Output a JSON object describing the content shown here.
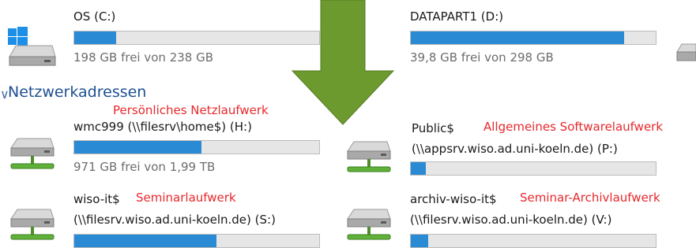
{
  "local_drives": [
    {
      "name": "OS (C:)",
      "free_text": "198 GB frei von 238 GB",
      "used_fraction": 0.17
    },
    {
      "name": "DATAPART1 (D:)",
      "free_text": "39,8 GB frei von 298 GB",
      "used_fraction": 0.87
    }
  ],
  "network_section": {
    "title": "Netzwerkadressen",
    "chevron_icon": "chevron-down-icon"
  },
  "network_drives": [
    {
      "name": "wmc999 (\\\\filesrv\\home$) (H:)",
      "annotation": "Persönliches Netzlaufwerk",
      "free_text": "971 GB frei von 1,99 TB",
      "used_fraction": 0.52
    },
    {
      "name": "Public$",
      "path": "(\\\\appsrv.wiso.ad.uni-koeln.de) (P:)",
      "annotation": "Allgemeines Softwarelaufwerk",
      "used_fraction": 0.06
    },
    {
      "name": "wiso-it$",
      "path": "(\\\\filesrv.wiso.ad.uni-koeln.de) (S:)",
      "annotation": "Seminarlaufwerk",
      "used_fraction": 0.58
    },
    {
      "name": "archiv-wiso-it$",
      "path": "(\\\\filesrv.wiso.ad.uni-koeln.de) (V:)",
      "annotation": "Seminar-Archivlaufwerk",
      "used_fraction": 0.07
    }
  ],
  "colors": {
    "bar_fill": "#2a8ad4",
    "annotation": "#e8282c",
    "arrow": "#6c9a2e",
    "section_title": "#1d4f91"
  },
  "overlay": {
    "arrow_icon": "green-down-arrow-icon"
  }
}
